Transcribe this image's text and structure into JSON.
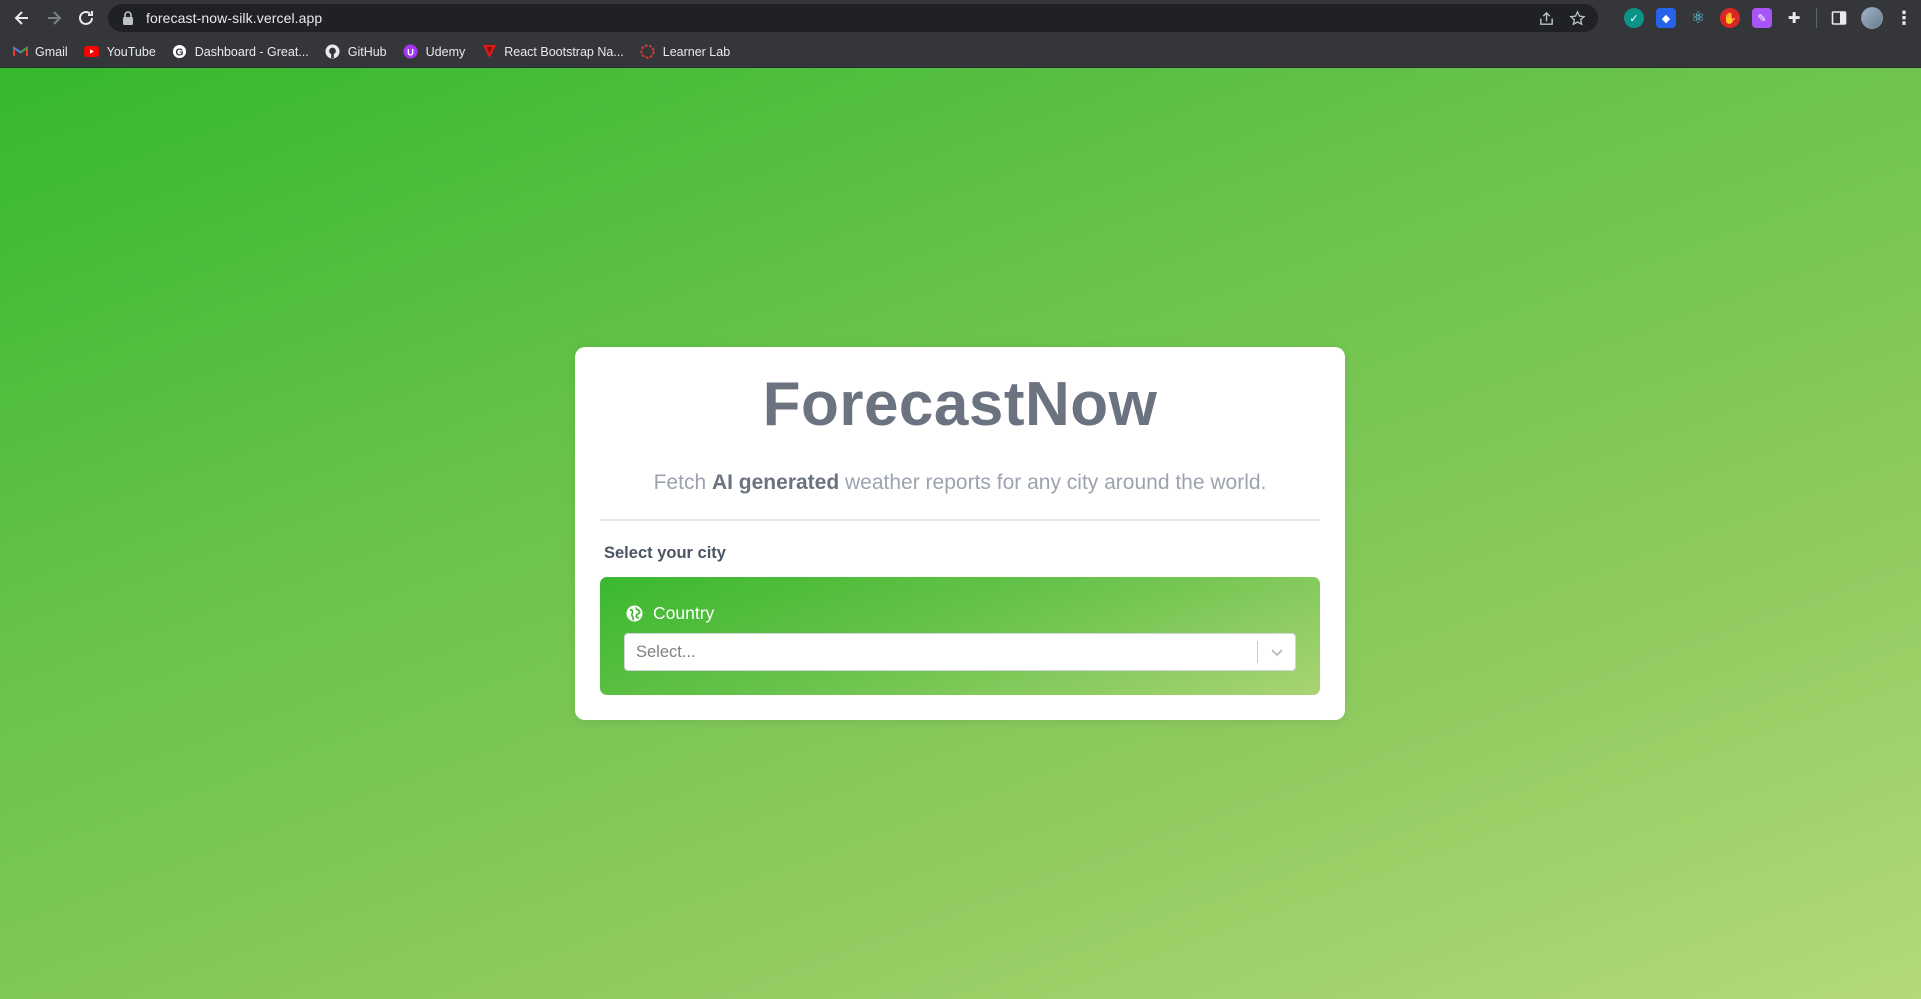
{
  "browser": {
    "url": "forecast-now-silk.vercel.app",
    "bookmarks": [
      {
        "label": "Gmail",
        "icon": "gmail-icon"
      },
      {
        "label": "YouTube",
        "icon": "youtube-icon"
      },
      {
        "label": "Dashboard - Great...",
        "icon": "google-icon"
      },
      {
        "label": "GitHub",
        "icon": "github-icon"
      },
      {
        "label": "Udemy",
        "icon": "udemy-icon"
      },
      {
        "label": "React Bootstrap Na...",
        "icon": "react-bootstrap-icon"
      },
      {
        "label": "Learner Lab",
        "icon": "learner-lab-icon"
      }
    ]
  },
  "app": {
    "title": "ForecastNow",
    "subtitle_prefix": "Fetch ",
    "subtitle_bold": "AI generated",
    "subtitle_suffix": " weather reports for any city around the world.",
    "select_label": "Select your city",
    "country_label": "Country",
    "country_placeholder": "Select..."
  },
  "colors": {
    "background_start": "#35b82e",
    "background_end": "#b4d978",
    "title_gray": "#6b7280",
    "card": "#ffffff"
  }
}
